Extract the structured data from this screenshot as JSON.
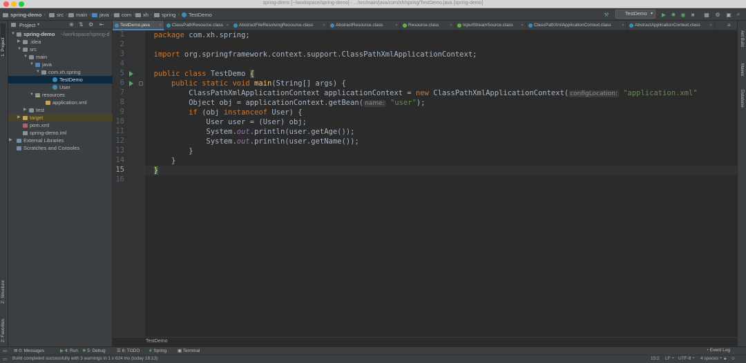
{
  "window": {
    "title": "spring-demo [~/workspace/spring-demo] - .../src/main/java/com/xh/spring/TestDemo.java [spring-demo]"
  },
  "breadcrumbs": [
    "spring-demo",
    "src",
    "main",
    "java",
    "com",
    "xh",
    "spring",
    "TestDemo"
  ],
  "run_config": {
    "label": "TestDemo"
  },
  "left_strip": {
    "project_tab": "1: Project",
    "structure_tab": "Z: Structure",
    "favorites_tab": "2: Favorites"
  },
  "right_strip": {
    "ant_build": "Ant Build",
    "maven": "Maven",
    "database": "Database"
  },
  "project_panel": {
    "header": "Project",
    "tree": [
      {
        "label": "spring-demo",
        "suffix": "~/workspace/spring-d"
      },
      {
        "label": ".idea"
      },
      {
        "label": "src"
      },
      {
        "label": "main"
      },
      {
        "label": "java"
      },
      {
        "label": "com.xh.spring"
      },
      {
        "label": "TestDemo"
      },
      {
        "label": "User"
      },
      {
        "label": "resources"
      },
      {
        "label": "application.xml"
      },
      {
        "label": "test"
      },
      {
        "label": "target"
      },
      {
        "label": "pom.xml"
      },
      {
        "label": "spring-demo.iml"
      },
      {
        "label": "External Libraries"
      },
      {
        "label": "Scratches and Consoles"
      }
    ]
  },
  "tabs": [
    "TestDemo.java",
    "ClassPathResource.class",
    "AbstractFileResolvingResource.class",
    "AbstractResource.class",
    "Resource.class",
    "InputStreamSource.class",
    "ClassPathXmlApplicationContext.class",
    "AbstractApplicationContext.class"
  ],
  "editor": {
    "line_numbers": [
      "1",
      "2",
      "3",
      "4",
      "5",
      "6",
      "7",
      "8",
      "9",
      "10",
      "11",
      "12",
      "13",
      "14",
      "15",
      "16"
    ],
    "lines": {
      "l1_kw": "package",
      "l1_rest": " com.xh.spring;",
      "l3_kw": "import",
      "l3_rest": " org.springframework.context.support.ClassPathXmlApplicationContext;",
      "l5_kw1": "public class",
      "l5_name": " TestDemo ",
      "l5_brace": "{",
      "l6_kw": "public static void",
      "l6_fn": " main",
      "l6_rest": "(String[] args) {",
      "l7_code": "ClassPathXmlApplicationContext applicationContext = ",
      "l7_new": "new",
      "l7_code2": " ClassPathXmlApplicationContext(",
      "l7_hint": "configLocation:",
      "l7_str": " \"application.xml\"",
      "l8_code": "Object obj = applicationContext.getBean(",
      "l8_hint": "name:",
      "l8_str": " \"user\"",
      "l8_end": ");",
      "l9_kw": "if",
      "l9_code": " (obj ",
      "l9_kw2": "instanceof",
      "l9_code2": " User) {",
      "l10_code": "User user = (User) obj;",
      "l11_a": "System.",
      "l11_out": "out",
      "l11_b": ".println(user.getAge());",
      "l12_a": "System.",
      "l12_out": "out",
      "l12_b": ".println(user.getName());",
      "l13": "}",
      "l14": "}",
      "l15": "}"
    },
    "breadcrumb": "TestDemo"
  },
  "tool_windows": [
    "0: Messages",
    "4: Run",
    "5: Debug",
    "6: TODO",
    "Spring",
    "Terminal",
    "Event Log"
  ],
  "status": {
    "message": "Build completed successfully with 3 warnings in 1 s 624 ms (today 18:13)",
    "position": "15:2",
    "line_sep": "LF ÷",
    "encoding": "UTF-8 ÷",
    "indent": "4 spaces ÷"
  },
  "colors": {
    "keyword": "#cc7832",
    "string": "#6a8759",
    "function": "#ffc66d",
    "static_field": "#9876aa",
    "selection": "#0d293e",
    "accent": "#4a88c7"
  }
}
